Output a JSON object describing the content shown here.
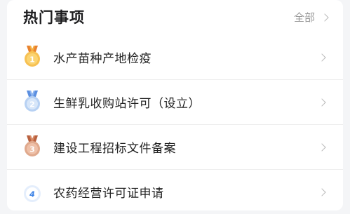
{
  "header": {
    "title": "热门事项",
    "more_label": "全部"
  },
  "items": [
    {
      "label": "水产苗种产地检疫",
      "icon": "gold-medal-icon",
      "rank": "1",
      "color": "#f0b13a"
    },
    {
      "label": "生鲜乳收购站许可（设立）",
      "icon": "silver-medal-icon",
      "rank": "2",
      "color": "#9fc1ec"
    },
    {
      "label": "建设工程招标文件备案",
      "icon": "bronze-medal-icon",
      "rank": "3",
      "color": "#d9a184"
    },
    {
      "label": "农药经营许可证申请",
      "icon": "rank-four-badge-icon",
      "rank": "4",
      "color": "#3b82e6"
    }
  ]
}
